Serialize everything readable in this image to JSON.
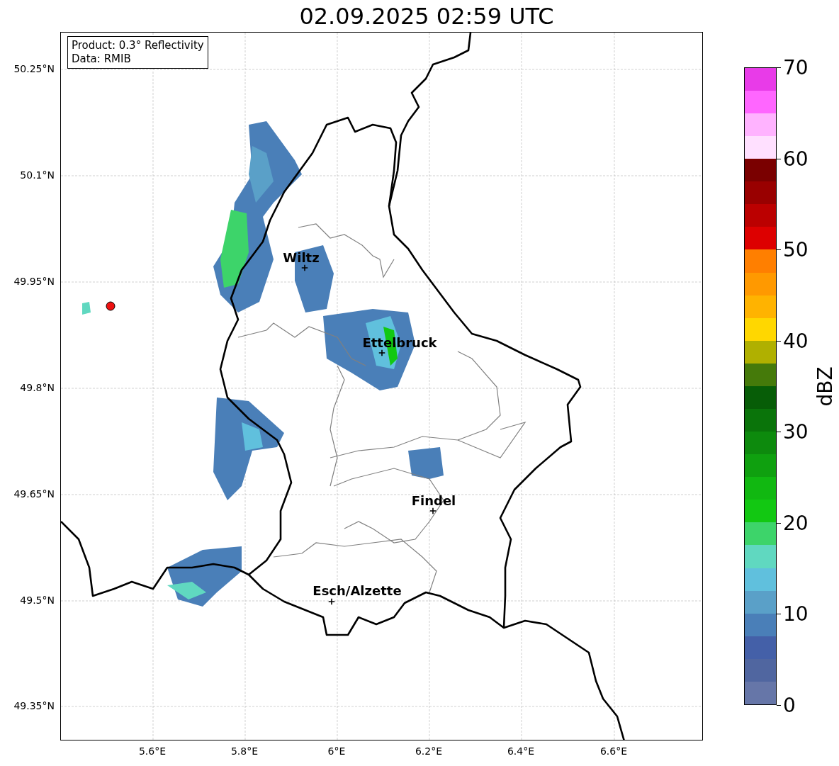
{
  "title": "02.09.2025 02:59 UTC",
  "legend": {
    "lines": [
      "Product: 0.3° Reflectivity",
      "Data: RMIB"
    ]
  },
  "lat_ticks": [
    "50.25°N",
    "50.1°N",
    "49.95°N",
    "49.8°N",
    "49.65°N",
    "49.5°N",
    "49.35°N"
  ],
  "lon_ticks": [
    "5.6°E",
    "5.8°E",
    "6°E",
    "6.2°E",
    "6.4°E",
    "6.6°E"
  ],
  "cities": [
    {
      "name": "Wiltz"
    },
    {
      "name": "Ettelbruck"
    },
    {
      "name": "Findel"
    },
    {
      "name": "Esch/Alzette"
    }
  ],
  "colorbar": {
    "label": "dBZ",
    "ticks": [
      "70",
      "60",
      "50",
      "40",
      "30",
      "20",
      "10",
      "0"
    ],
    "segments": [
      {
        "color": "#6676a8"
      },
      {
        "color": "#5066a0"
      },
      {
        "color": "#4460a8"
      },
      {
        "color": "#4a7fb8"
      },
      {
        "color": "#5aa0c8"
      },
      {
        "color": "#60c0dd"
      },
      {
        "color": "#60d8c0"
      },
      {
        "color": "#3dd46a"
      },
      {
        "color": "#12c812"
      },
      {
        "color": "#11b811"
      },
      {
        "color": "#0fa00f"
      },
      {
        "color": "#0d8a0d"
      },
      {
        "color": "#0a740a"
      },
      {
        "color": "#075d07"
      },
      {
        "color": "#457a0a"
      },
      {
        "color": "#b0b000"
      },
      {
        "color": "#ffd700"
      },
      {
        "color": "#ffb300"
      },
      {
        "color": "#ff9900"
      },
      {
        "color": "#ff7f00"
      },
      {
        "color": "#dd0000"
      },
      {
        "color": "#bb0000"
      },
      {
        "color": "#990000"
      },
      {
        "color": "#7a0000"
      },
      {
        "color": "#ffe0ff"
      },
      {
        "color": "#ffb3ff"
      },
      {
        "color": "#ff66ff"
      },
      {
        "color": "#e83be8"
      }
    ]
  }
}
